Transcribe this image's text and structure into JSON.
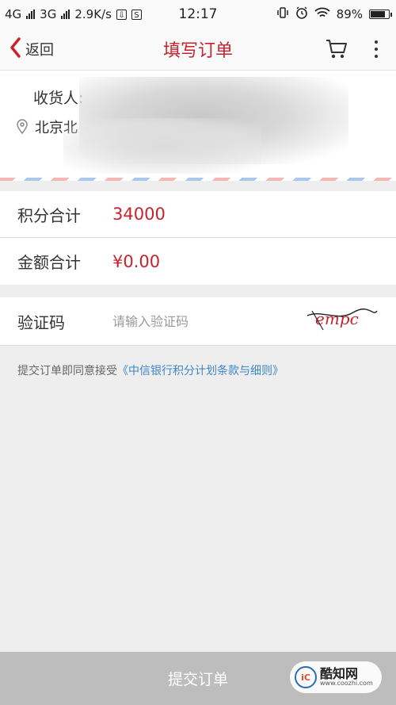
{
  "status_bar": {
    "net1": "4G",
    "net2": "3G",
    "speed": "2.9K/s",
    "time": "12:17",
    "battery": "89%",
    "battery_level": 0.89,
    "sb_icon_s": "S"
  },
  "nav": {
    "back_label": "返回",
    "title": "填写订单"
  },
  "address": {
    "recipient_label": "收货人:",
    "address_text": "北京北"
  },
  "points": {
    "label": "积分合计",
    "value": "34000"
  },
  "amount": {
    "label": "金额合计",
    "value": "¥0.00"
  },
  "captcha": {
    "label": "验证码",
    "placeholder": "请输入验证码",
    "image_text": "empc"
  },
  "agreement": {
    "prefix": "提交订单即同意接受",
    "link": "《中信银行积分计划条款与细则》"
  },
  "submit": {
    "label": "提交订单"
  },
  "watermark": {
    "logo": "iC",
    "title": "酷知网",
    "url": "www.coozhi.com"
  },
  "colors": {
    "accent": "#c8232c",
    "link": "#3e86c6",
    "submit_bg": "#bdbdbd"
  }
}
